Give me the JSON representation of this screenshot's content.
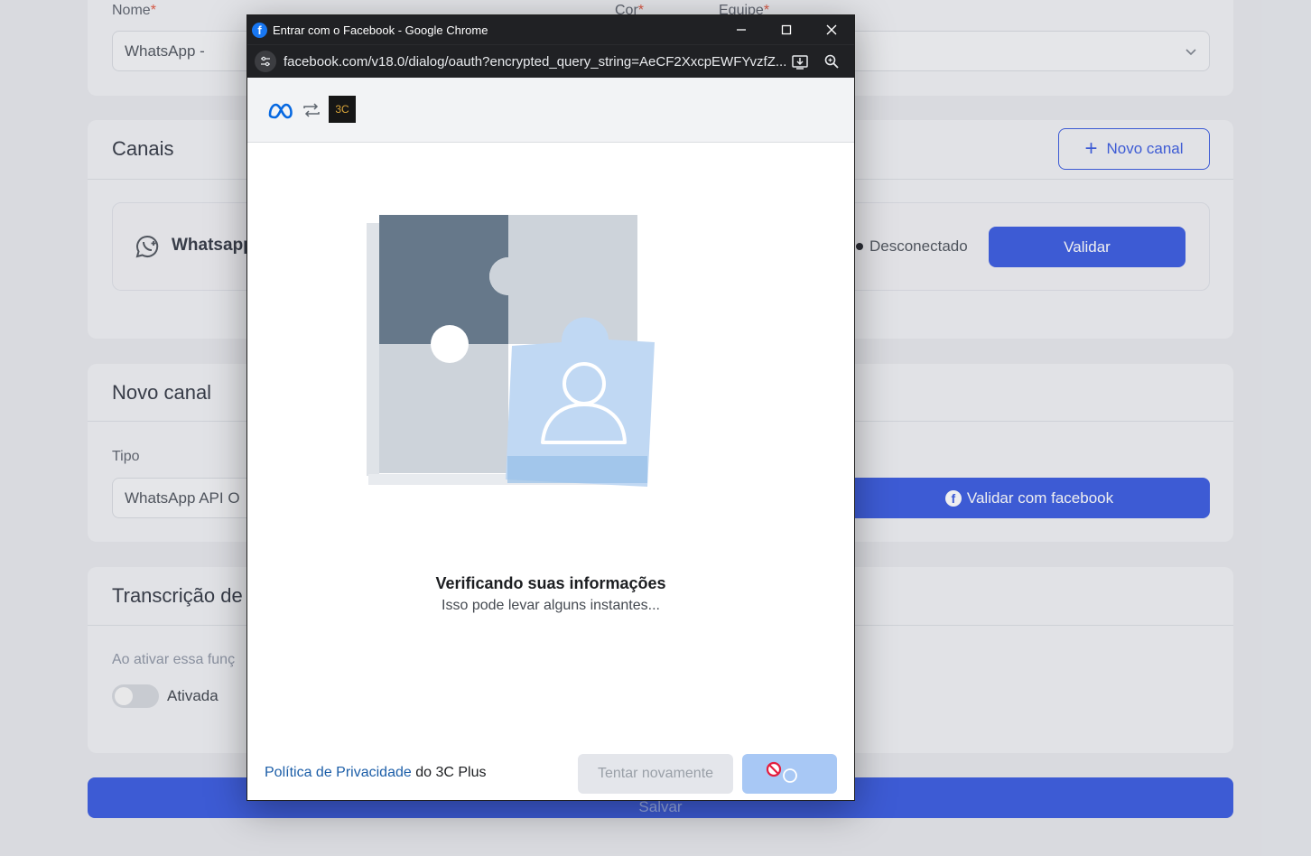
{
  "form": {
    "name_label": "Nome",
    "name_value": "WhatsApp -",
    "color_label": "Cor",
    "team_label": "Equipe",
    "required_mark": "*"
  },
  "channels": {
    "title": "Canais",
    "new_channel_button": "Novo canal",
    "channel_name": "Whatsapp",
    "status": "Desconectado",
    "validate_button": "Validar"
  },
  "new_channel": {
    "title": "Novo canal",
    "type_label": "Tipo",
    "type_value": "WhatsApp API O",
    "validate_facebook_button": "Validar com facebook"
  },
  "transcription": {
    "title": "Transcrição de",
    "description": "Ao ativar essa funç",
    "toggle_label": "Ativada",
    "toggle_on": false
  },
  "save_button": "Salvar",
  "popup": {
    "window_title": "Entrar com o Facebook - Google Chrome",
    "url": "facebook.com/v18.0/dialog/oauth?encrypted_query_string=AeCF2XxcpEWFYvzfZ...",
    "brand_badge": "3C",
    "status_title": "Verificando suas informações",
    "status_subtitle": "Isso pode levar alguns instantes...",
    "privacy_link": "Política de Privacidade",
    "privacy_suffix": " do 3C Plus",
    "retry_button": "Tentar novamente"
  },
  "colors": {
    "primary": "#3557e0",
    "facebook": "#1877f2",
    "meta": "#0668e1"
  }
}
